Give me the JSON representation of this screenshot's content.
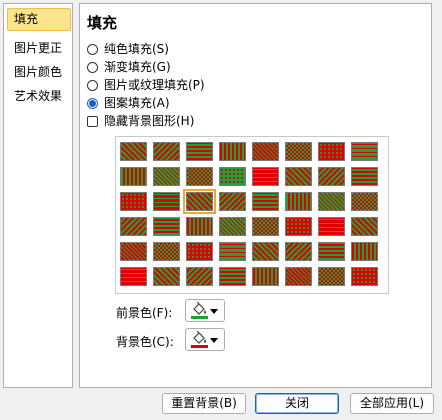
{
  "sidebar": {
    "items": [
      {
        "label": "填充",
        "selected": true
      },
      {
        "label": "图片更正",
        "selected": false
      },
      {
        "label": "图片颜色",
        "selected": false
      },
      {
        "label": "艺术效果",
        "selected": false
      }
    ]
  },
  "panel": {
    "title": "填充",
    "options": [
      {
        "label": "纯色填充(S)",
        "checked": false
      },
      {
        "label": "渐变填充(G)",
        "checked": false
      },
      {
        "label": "图片或纹理填充(P)",
        "checked": false
      },
      {
        "label": "图案填充(A)",
        "checked": true
      }
    ],
    "hide_background": {
      "label": "隐藏背景图形(H)",
      "checked": false
    },
    "pattern_grid": {
      "rows": 6,
      "cols": 8,
      "selected": {
        "row": 2,
        "col": 2
      },
      "foreground_color": "#e00000",
      "background_color": "#1aa33a"
    },
    "foreground": {
      "label": "前景色(F):",
      "icon": "paint-bucket-icon",
      "color": "#1aa33a"
    },
    "background": {
      "label": "背景色(C):",
      "icon": "paint-bucket-icon",
      "color": "#e00000"
    }
  },
  "footer": {
    "reset_label": "重置背景(B)",
    "close_label": "关闭",
    "apply_all_label": "全部应用(L)"
  },
  "colors": {
    "accent": "#1e5cc6",
    "selection_fill": "#fde48c",
    "selection_border": "#f0be4b"
  }
}
